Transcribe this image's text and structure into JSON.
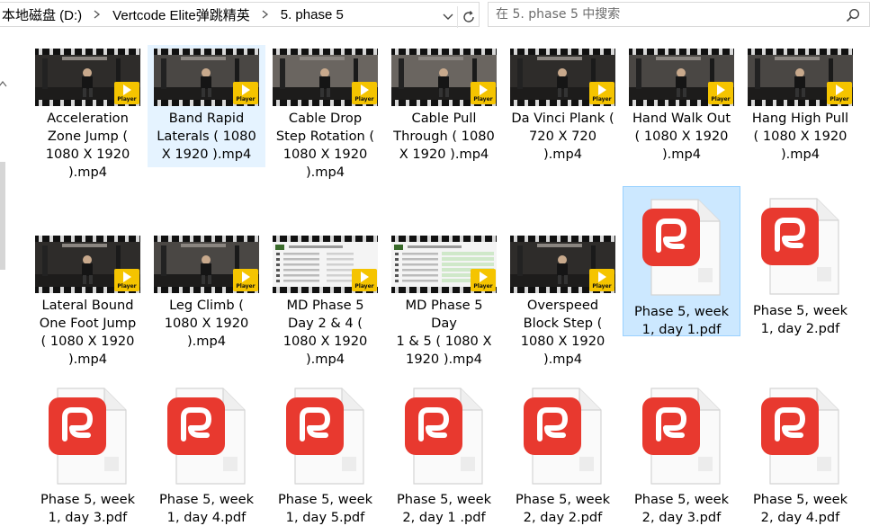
{
  "breadcrumb": [
    "本地磁盘 (D:)",
    "Vertcode Elite弹跳精英",
    "5. phase 5"
  ],
  "search": {
    "placeholder": "在 5. phase 5 中搜索"
  },
  "player_badge_label": "Player",
  "colors": {
    "selected_bg": "#cce8ff",
    "selected_border": "#99d1ff",
    "hover_bg": "#e5f3ff",
    "pdf_red": "#e8392f",
    "player_yellow": "#f5c400"
  },
  "files": [
    {
      "name": "Acceleration Zone Jump ( 1080 X 1920 ).mp4",
      "type": "video",
      "lines": [
        "Acceleration",
        "Zone Jump (",
        "1080 X 1920",
        ").mp4"
      ],
      "frame": "gym-dark"
    },
    {
      "name": "Band Rapid Laterals ( 1080 X 1920 ).mp4",
      "type": "video",
      "lines": [
        "Band Rapid",
        "Laterals ( 1080",
        "X 1920 ).mp4"
      ],
      "frame": "gym-mid",
      "state": "hover"
    },
    {
      "name": "Cable Drop Step Rotation ( 1080 X 1920 ).mp4",
      "type": "video",
      "lines": [
        "Cable Drop",
        "Step Rotation (",
        "1080 X 1920",
        ").mp4"
      ],
      "frame": "gym-light"
    },
    {
      "name": "Cable Pull Through ( 1080 X 1920 ).mp4",
      "type": "video",
      "lines": [
        "Cable Pull",
        "Through ( 1080",
        "X 1920 ).mp4"
      ],
      "frame": "gym-light"
    },
    {
      "name": "Da Vinci Plank ( 720 X 720 ).mp4",
      "type": "video",
      "lines": [
        "Da Vinci Plank (",
        "720 X 720",
        ").mp4"
      ],
      "frame": "gym-dark"
    },
    {
      "name": "Hand Walk Out ( 1080 X 1920 ).mp4",
      "type": "video",
      "lines": [
        "Hand Walk Out",
        "( 1080 X 1920",
        ").mp4"
      ],
      "frame": "gym-mid"
    },
    {
      "name": "Hang High Pull ( 1080 X 1920 ).mp4",
      "type": "video",
      "lines": [
        "Hang High Pull",
        "( 1080 X 1920",
        ").mp4"
      ],
      "frame": "gym-mid"
    },
    {
      "name": "Lateral Bound One Foot Jump ( 1080 X 1920 ).mp4",
      "type": "video",
      "lines": [
        "Lateral Bound",
        "One Foot Jump",
        "( 1080 X 1920",
        ").mp4"
      ],
      "frame": "gym-dark"
    },
    {
      "name": "Leg Climb ( 1080 X 1920 ).mp4",
      "type": "video",
      "lines": [
        "Leg Climb (",
        "1080 X 1920",
        ").mp4"
      ],
      "frame": "gym-mid"
    },
    {
      "name": "MD Phase 5 Day 2 & 4 ( 1080 X 1920 ).mp4",
      "type": "video",
      "lines": [
        "MD Phase 5",
        "Day 2 & 4 (",
        "1080 X 1920",
        ").mp4"
      ],
      "frame": "doc"
    },
    {
      "name": "MD Phase 5 Day 1 & 5 ( 1080 X 1920 ).mp4",
      "type": "video",
      "lines": [
        "MD Phase 5 Day",
        "1 & 5 ( 1080 X",
        "1920 ).mp4"
      ],
      "frame": "doc-green"
    },
    {
      "name": "Overspeed Block Step ( 1080 X 1920 ).mp4",
      "type": "video",
      "lines": [
        "Overspeed",
        "Block Step (",
        "1080 X 1920",
        ").mp4"
      ],
      "frame": "gym-dark"
    },
    {
      "name": "Phase 5, week 1, day 1.pdf",
      "type": "pdf",
      "lines": [
        "Phase 5, week",
        "1, day 1.pdf"
      ],
      "state": "selected"
    },
    {
      "name": "Phase 5, week 1, day 2.pdf",
      "type": "pdf",
      "lines": [
        "Phase 5, week",
        "1, day 2.pdf"
      ]
    },
    {
      "name": "Phase 5, week 1, day 3.pdf",
      "type": "pdf",
      "lines": [
        "Phase 5, week",
        "1, day 3.pdf"
      ]
    },
    {
      "name": "Phase 5, week 1, day 4.pdf",
      "type": "pdf",
      "lines": [
        "Phase 5, week",
        "1, day 4.pdf"
      ]
    },
    {
      "name": "Phase 5, week 1, day 5.pdf",
      "type": "pdf",
      "lines": [
        "Phase 5, week",
        "1, day 5.pdf"
      ]
    },
    {
      "name": "Phase 5, week 2, day 1 .pdf",
      "type": "pdf",
      "lines": [
        "Phase 5, week",
        "2, day 1 .pdf"
      ]
    },
    {
      "name": "Phase 5, week 2, day 2.pdf",
      "type": "pdf",
      "lines": [
        "Phase 5, week",
        "2, day 2.pdf"
      ]
    },
    {
      "name": "Phase 5, week 2, day 3.pdf",
      "type": "pdf",
      "lines": [
        "Phase 5, week",
        "2, day 3.pdf"
      ]
    },
    {
      "name": "Phase 5, week 2, day 4.pdf",
      "type": "pdf",
      "lines": [
        "Phase 5, week",
        "2, day 4.pdf"
      ]
    }
  ]
}
